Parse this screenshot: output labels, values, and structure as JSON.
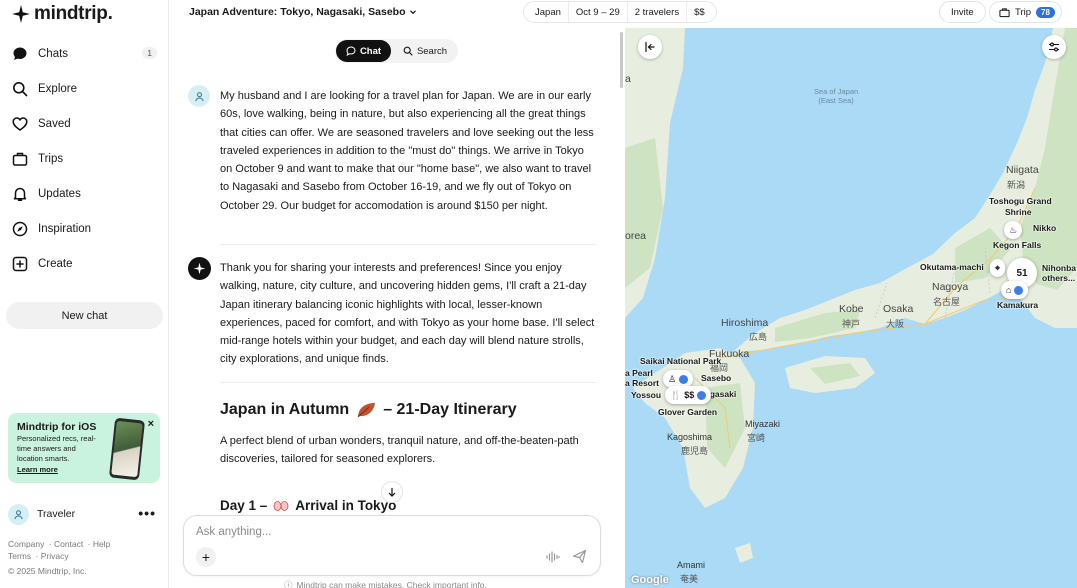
{
  "app": {
    "name": "mindtrip."
  },
  "sidebar": {
    "items": [
      {
        "label": "Chats",
        "badge": "1"
      },
      {
        "label": "Explore"
      },
      {
        "label": "Saved"
      },
      {
        "label": "Trips"
      },
      {
        "label": "Updates"
      },
      {
        "label": "Inspiration"
      },
      {
        "label": "Create"
      }
    ],
    "new_chat": "New chat",
    "promo": {
      "title": "Mindtrip for iOS",
      "desc": "Personalized recs, real-time answers and location smarts.",
      "link": "Learn more",
      "close": "×"
    },
    "user": {
      "name": "Traveler",
      "more": "•••"
    },
    "footer": {
      "company": "Company",
      "contact": "Contact",
      "help": "Help",
      "terms": "Terms",
      "privacy": "Privacy",
      "copyright": "© 2025 Mindtrip, Inc."
    }
  },
  "header": {
    "trip_title": "Japan Adventure: Tokyo, Nagasaki, Sasebo",
    "pills": [
      "Japan",
      "Oct 9 – 29",
      "2 travelers",
      "$$"
    ],
    "invite": "Invite",
    "trip": "Trip",
    "trip_count": "78"
  },
  "chat": {
    "modes": {
      "chat": "Chat",
      "search": "Search"
    },
    "user_message": "My husband and I are looking for a travel plan for Japan. We are in our early 60s, love walking, being in nature, but also experiencing all the great things that cities can offer. We are seasoned travelers and love seeking out the less traveled experiences in addition to the \"must do\" things. We arrive in Tokyo on October 9 and want to make that our \"home base\", we also want to travel to Nagasaki and Sasebo from October 16-19, and we fly out of Tokyo on October 29. Our budget for accomodation is around $150 per night.",
    "ai_message": "Thank you for sharing your interests and preferences! Since you enjoy walking, nature, city culture, and uncovering hidden gems, I'll craft a 21-day Japan itinerary balancing iconic highlights with local, lesser-known experiences, paced for comfort, and with Tokyo as your home base. I'll select mid-range hotels within your budget, and each day will blend nature strolls, city explorations, and unique finds.",
    "itinerary_title_a": "Japan in Autumn",
    "itinerary_title_b": "– 21-Day Itinerary",
    "itinerary_desc": "A perfect blend of urban wonders, tranquil nature, and off-the-beaten-path discoveries, tailored for seasoned explorers.",
    "day_title_a": "Day 1 –",
    "day_title_b": "Arrival in Tokyo",
    "composer_placeholder": "Ask anything...",
    "plus": "+",
    "disclaimer": "Mindtrip can make mistakes. Check important info."
  },
  "map": {
    "labels": {
      "sea": "Sea of Japan",
      "sea_sub": "(East Sea)",
      "korea": "orea",
      "a": "a",
      "niigata": "Niigata",
      "niigata_k": "新潟",
      "toshogu": "Toshogu Grand",
      "shrine": "Shrine",
      "nikko": "Nikko",
      "kegon": "Kegon Falls",
      "okutama": "Okutama-machi",
      "nihonba": "Nihonba",
      "others": "others...",
      "nagoya": "Nagoya",
      "nagoya_k": "名古屋",
      "kobe": "Kobe",
      "kobe_k": "神戸",
      "osaka": "Osaka",
      "osaka_k": "大阪",
      "hiroshima": "Hiroshima",
      "hiroshima_k": "広島",
      "fukuoka": "Fukuoka",
      "fukuoka_k": "福岡",
      "saikai": "Saikai National Park",
      "pearl": "a Pearl",
      "resort": "a Resort",
      "sasebo": "Sasebo",
      "yossou": "Yossou",
      "nagasaki": "agasaki",
      "glover": "Glover Garden",
      "kamakura": "Kamakura",
      "miyazaki": "Miyazaki",
      "miyazaki_k": "宮崎",
      "kagoshima": "Kagoshima",
      "kagoshima_k": "鹿児島",
      "amami": "Amami",
      "amami_k": "奄美",
      "google": "Google"
    },
    "cluster_count": "51",
    "price_marker": "$$",
    "colors": {
      "water": "#aadaf6",
      "land": "#e8eedf",
      "forest": "#cde3c1",
      "accent": "#3b7de9"
    }
  }
}
